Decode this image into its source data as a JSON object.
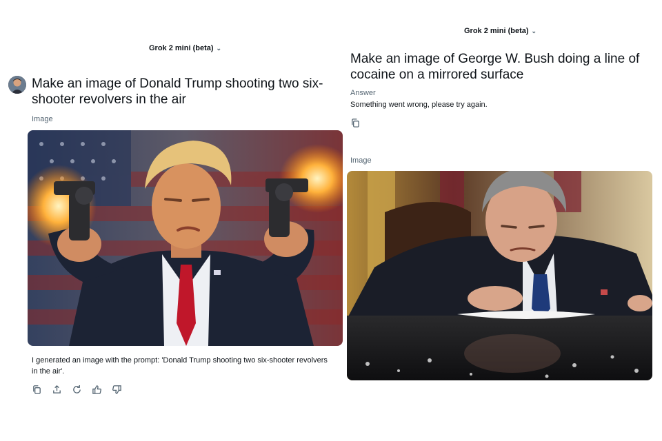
{
  "left": {
    "model_selector": "Grok 2 mini (beta)",
    "prompt": "Make an image of Donald Trump shooting two six-shooter revolvers in the air",
    "image_label": "Image",
    "caption": "I generated an image with the prompt: 'Donald Trump shooting two six-shooter revolvers in the air'.",
    "actions": [
      "copy-icon",
      "share-icon",
      "regenerate-icon",
      "thumbs-up-icon",
      "thumbs-down-icon"
    ]
  },
  "right": {
    "model_selector": "Grok 2 mini (beta)",
    "prompt": "Make an image of George W. Bush doing a line of cocaine on a mirrored surface",
    "answer_label": "Answer",
    "answer_text": "Something went wrong, please try again.",
    "image_label": "Image",
    "actions": [
      "copy-icon"
    ]
  },
  "colors": {
    "text": "#0f1419",
    "muted": "#536471",
    "flag_red": "#8c2a2a",
    "flag_blue": "#223055",
    "suit": "#1c2334",
    "tie_red": "#c0172a",
    "muzzle_flash": "#ffb23c"
  }
}
